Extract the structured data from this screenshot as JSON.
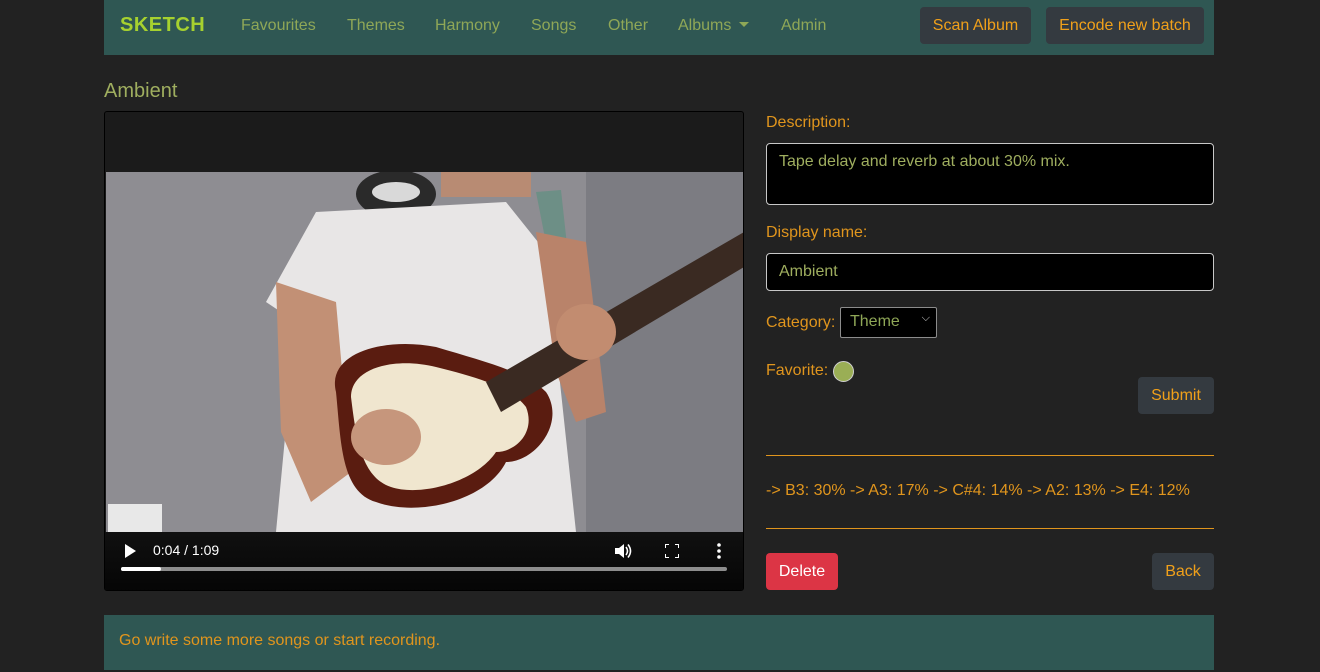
{
  "nav": {
    "brand": "SKETCH",
    "items": [
      {
        "label": "Favourites"
      },
      {
        "label": "Themes"
      },
      {
        "label": "Harmony"
      },
      {
        "label": "Songs"
      },
      {
        "label": "Other"
      },
      {
        "label": "Albums"
      },
      {
        "label": "Admin"
      }
    ],
    "scan_label": "Scan Album",
    "encode_label": "Encode new batch"
  },
  "page": {
    "title": "Ambient"
  },
  "video": {
    "current_time": "0:04",
    "duration": "1:09",
    "time_text": "0:04 / 1:09",
    "progress": 0.066
  },
  "form": {
    "description_label": "Description:",
    "description_value": "Tape delay and reverb at about 30% mix.",
    "display_name_label": "Display name:",
    "display_name_value": "Ambient",
    "category_label": "Category:",
    "category_value": "Theme",
    "favorite_label": "Favorite:",
    "submit_label": "Submit"
  },
  "analysis": {
    "notes": "-> B3: 30% -> A3: 17% -> C#4: 14% -> A2: 13% -> E4: 12%"
  },
  "actions": {
    "delete_label": "Delete",
    "back_label": "Back"
  },
  "footer": {
    "message": "Go write some more songs or start recording."
  },
  "colors": {
    "navbar_bg": "#2f5753",
    "page_bg": "#222222",
    "accent_orange": "#e0951d",
    "brand_green": "#a6d12f",
    "danger": "#dc3545"
  }
}
